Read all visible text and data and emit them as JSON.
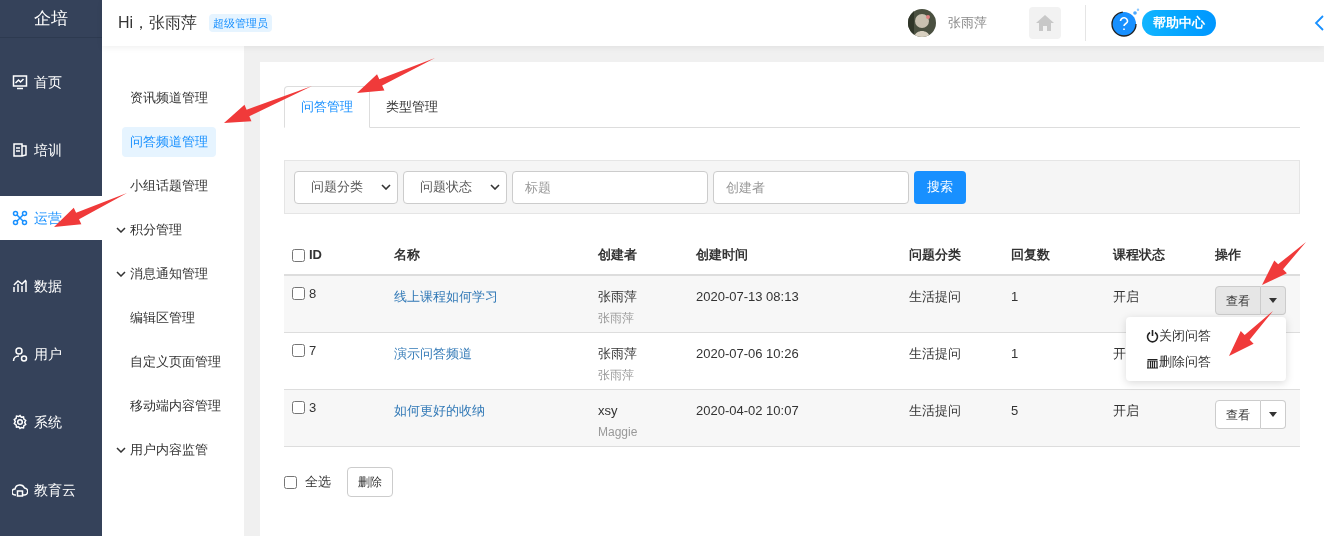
{
  "logo": "企培",
  "greeting": "Hi，张雨萍",
  "role_badge": "超级管理员",
  "user": {
    "name": "张雨萍"
  },
  "help": "帮助中心",
  "nav": [
    {
      "label": "首页",
      "selected": false
    },
    {
      "label": "培训",
      "selected": false
    },
    {
      "label": "运营",
      "selected": true
    },
    {
      "label": "数据",
      "selected": false
    },
    {
      "label": "用户",
      "selected": false
    },
    {
      "label": "系统",
      "selected": false
    },
    {
      "label": "教育云",
      "selected": false
    }
  ],
  "subnav": [
    {
      "label": "资讯频道管理",
      "kind": "link",
      "selected": false
    },
    {
      "label": "问答频道管理",
      "kind": "link",
      "selected": true
    },
    {
      "label": "小组话题管理",
      "kind": "link",
      "selected": false
    },
    {
      "label": "积分管理",
      "kind": "group",
      "selected": false
    },
    {
      "label": "消息通知管理",
      "kind": "group",
      "selected": false
    },
    {
      "label": "编辑区管理",
      "kind": "link",
      "selected": false
    },
    {
      "label": "自定义页面管理",
      "kind": "link",
      "selected": false
    },
    {
      "label": "移动端内容管理",
      "kind": "link",
      "selected": false
    },
    {
      "label": "用户内容监管",
      "kind": "group",
      "selected": false
    }
  ],
  "tabs": [
    {
      "label": "问答管理",
      "selected": true
    },
    {
      "label": "类型管理",
      "selected": false
    }
  ],
  "filters": {
    "selects": [
      "问题分类",
      "问题状态"
    ],
    "inputs": [
      {
        "placeholder": "标题"
      },
      {
        "placeholder": "创建者"
      }
    ],
    "search_button": "搜索"
  },
  "table": {
    "select_all_checked": false,
    "columns": [
      "ID",
      "名称",
      "创建者",
      "创建时间",
      "问题分类",
      "回复数",
      "课程状态",
      "操作"
    ],
    "rows": [
      {
        "checked": false,
        "id": "8",
        "name": "线上课程如何学习",
        "creator": "张雨萍",
        "creator_sub": "张雨萍",
        "time": "2020-07-13 08:13",
        "category": "生活提问",
        "replies": "1",
        "status": "开启",
        "view_button": "查看",
        "dropdown_open": true,
        "dropdown": [
          {
            "label": "关闭问答",
            "kind": "power"
          },
          {
            "label": "删除问答",
            "kind": "trash"
          }
        ]
      },
      {
        "checked": false,
        "id": "7",
        "name": "演示问答频道",
        "creator": "张雨萍",
        "creator_sub": "张雨萍",
        "time": "2020-07-06 10:26",
        "category": "生活提问",
        "replies": "1",
        "status": "开"
      },
      {
        "checked": false,
        "id": "3",
        "name": "如何更好的收纳",
        "creator": "xsy",
        "creator_sub": "Maggie",
        "time": "2020-04-02 10:07",
        "category": "生活提问",
        "replies": "5",
        "status": "开启",
        "view_button": "查看",
        "dropdown_open": false
      }
    ]
  },
  "footer": {
    "select_all": "全选",
    "checked": false,
    "delete_button": "删除"
  }
}
